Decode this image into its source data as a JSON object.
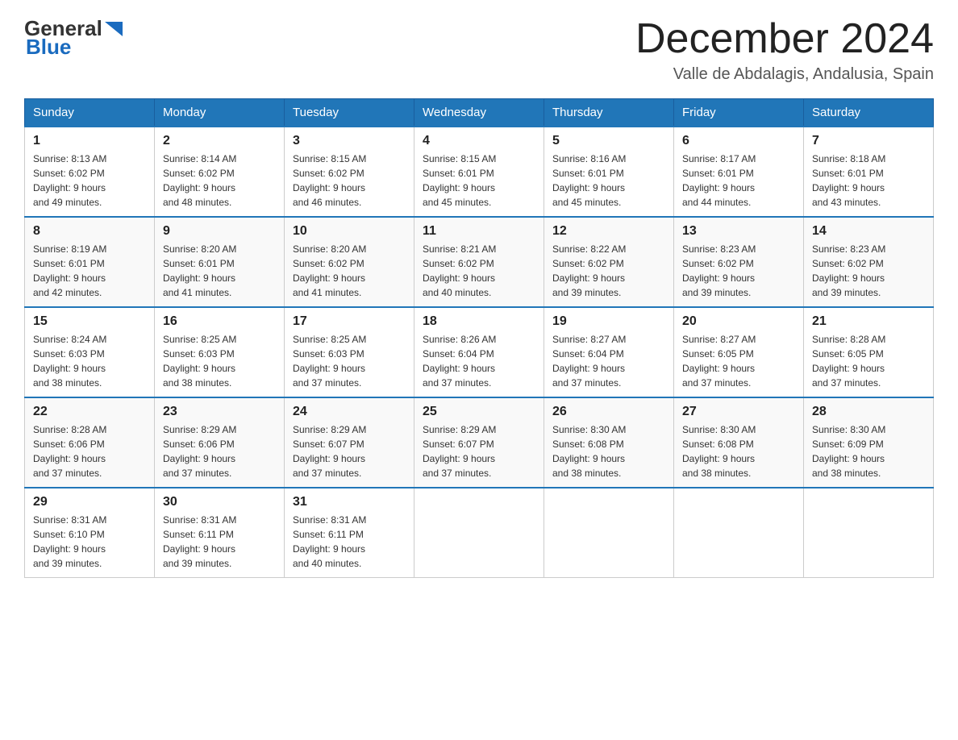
{
  "logo": {
    "general": "General",
    "blue": "Blue"
  },
  "title": "December 2024",
  "subtitle": "Valle de Abdalagis, Andalusia, Spain",
  "days_of_week": [
    "Sunday",
    "Monday",
    "Tuesday",
    "Wednesday",
    "Thursday",
    "Friday",
    "Saturday"
  ],
  "weeks": [
    [
      {
        "day": "1",
        "sunrise": "8:13 AM",
        "sunset": "6:02 PM",
        "daylight": "9 hours and 49 minutes."
      },
      {
        "day": "2",
        "sunrise": "8:14 AM",
        "sunset": "6:02 PM",
        "daylight": "9 hours and 48 minutes."
      },
      {
        "day": "3",
        "sunrise": "8:15 AM",
        "sunset": "6:02 PM",
        "daylight": "9 hours and 46 minutes."
      },
      {
        "day": "4",
        "sunrise": "8:15 AM",
        "sunset": "6:01 PM",
        "daylight": "9 hours and 45 minutes."
      },
      {
        "day": "5",
        "sunrise": "8:16 AM",
        "sunset": "6:01 PM",
        "daylight": "9 hours and 45 minutes."
      },
      {
        "day": "6",
        "sunrise": "8:17 AM",
        "sunset": "6:01 PM",
        "daylight": "9 hours and 44 minutes."
      },
      {
        "day": "7",
        "sunrise": "8:18 AM",
        "sunset": "6:01 PM",
        "daylight": "9 hours and 43 minutes."
      }
    ],
    [
      {
        "day": "8",
        "sunrise": "8:19 AM",
        "sunset": "6:01 PM",
        "daylight": "9 hours and 42 minutes."
      },
      {
        "day": "9",
        "sunrise": "8:20 AM",
        "sunset": "6:01 PM",
        "daylight": "9 hours and 41 minutes."
      },
      {
        "day": "10",
        "sunrise": "8:20 AM",
        "sunset": "6:02 PM",
        "daylight": "9 hours and 41 minutes."
      },
      {
        "day": "11",
        "sunrise": "8:21 AM",
        "sunset": "6:02 PM",
        "daylight": "9 hours and 40 minutes."
      },
      {
        "day": "12",
        "sunrise": "8:22 AM",
        "sunset": "6:02 PM",
        "daylight": "9 hours and 39 minutes."
      },
      {
        "day": "13",
        "sunrise": "8:23 AM",
        "sunset": "6:02 PM",
        "daylight": "9 hours and 39 minutes."
      },
      {
        "day": "14",
        "sunrise": "8:23 AM",
        "sunset": "6:02 PM",
        "daylight": "9 hours and 39 minutes."
      }
    ],
    [
      {
        "day": "15",
        "sunrise": "8:24 AM",
        "sunset": "6:03 PM",
        "daylight": "9 hours and 38 minutes."
      },
      {
        "day": "16",
        "sunrise": "8:25 AM",
        "sunset": "6:03 PM",
        "daylight": "9 hours and 38 minutes."
      },
      {
        "day": "17",
        "sunrise": "8:25 AM",
        "sunset": "6:03 PM",
        "daylight": "9 hours and 37 minutes."
      },
      {
        "day": "18",
        "sunrise": "8:26 AM",
        "sunset": "6:04 PM",
        "daylight": "9 hours and 37 minutes."
      },
      {
        "day": "19",
        "sunrise": "8:27 AM",
        "sunset": "6:04 PM",
        "daylight": "9 hours and 37 minutes."
      },
      {
        "day": "20",
        "sunrise": "8:27 AM",
        "sunset": "6:05 PM",
        "daylight": "9 hours and 37 minutes."
      },
      {
        "day": "21",
        "sunrise": "8:28 AM",
        "sunset": "6:05 PM",
        "daylight": "9 hours and 37 minutes."
      }
    ],
    [
      {
        "day": "22",
        "sunrise": "8:28 AM",
        "sunset": "6:06 PM",
        "daylight": "9 hours and 37 minutes."
      },
      {
        "day": "23",
        "sunrise": "8:29 AM",
        "sunset": "6:06 PM",
        "daylight": "9 hours and 37 minutes."
      },
      {
        "day": "24",
        "sunrise": "8:29 AM",
        "sunset": "6:07 PM",
        "daylight": "9 hours and 37 minutes."
      },
      {
        "day": "25",
        "sunrise": "8:29 AM",
        "sunset": "6:07 PM",
        "daylight": "9 hours and 37 minutes."
      },
      {
        "day": "26",
        "sunrise": "8:30 AM",
        "sunset": "6:08 PM",
        "daylight": "9 hours and 38 minutes."
      },
      {
        "day": "27",
        "sunrise": "8:30 AM",
        "sunset": "6:08 PM",
        "daylight": "9 hours and 38 minutes."
      },
      {
        "day": "28",
        "sunrise": "8:30 AM",
        "sunset": "6:09 PM",
        "daylight": "9 hours and 38 minutes."
      }
    ],
    [
      {
        "day": "29",
        "sunrise": "8:31 AM",
        "sunset": "6:10 PM",
        "daylight": "9 hours and 39 minutes."
      },
      {
        "day": "30",
        "sunrise": "8:31 AM",
        "sunset": "6:11 PM",
        "daylight": "9 hours and 39 minutes."
      },
      {
        "day": "31",
        "sunrise": "8:31 AM",
        "sunset": "6:11 PM",
        "daylight": "9 hours and 40 minutes."
      },
      null,
      null,
      null,
      null
    ]
  ],
  "labels": {
    "sunrise": "Sunrise:",
    "sunset": "Sunset:",
    "daylight": "Daylight:"
  }
}
